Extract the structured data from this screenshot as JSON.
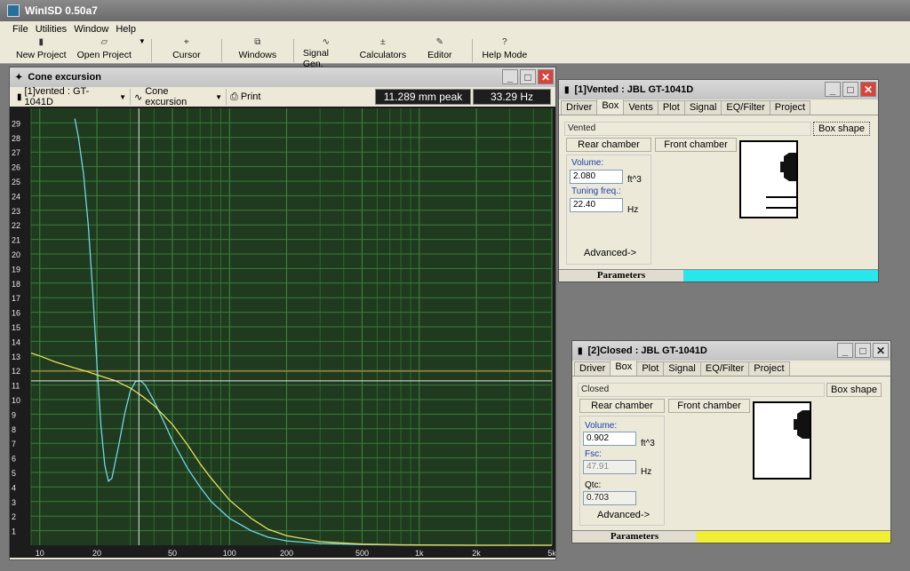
{
  "app": {
    "title": "WinISD 0.50a7"
  },
  "menu": [
    "File",
    "Utilities",
    "Window",
    "Help"
  ],
  "toolbar": [
    {
      "label": "New Project",
      "icon": "new-project-icon",
      "glyph": "▮"
    },
    {
      "label": "Open Project",
      "icon": "open-project-icon",
      "glyph": "▱"
    },
    {
      "label": "Cursor",
      "icon": "cursor-icon",
      "glyph": "⌖"
    },
    {
      "label": "Windows",
      "icon": "windows-icon",
      "glyph": "⧉"
    },
    {
      "label": "Signal Gen.",
      "icon": "signal-icon",
      "glyph": "∿"
    },
    {
      "label": "Calculators",
      "icon": "calculator-icon",
      "glyph": "±"
    },
    {
      "label": "Editor",
      "icon": "editor-icon",
      "glyph": "✎"
    },
    {
      "label": "Help Mode",
      "icon": "help-icon",
      "glyph": "?"
    }
  ],
  "cone": {
    "title": "Cone excursion",
    "project_select": "[1]vented : GT-1041D",
    "plot_select": "Cone excursion",
    "print_label": "Print",
    "readout_peak": "11.289 mm peak",
    "readout_freq": "33.29 Hz"
  },
  "chart_data": {
    "type": "line",
    "title": "",
    "xlabel": "",
    "ylabel": "",
    "xscale": "log",
    "xlim": [
      9,
      5000
    ],
    "ylim": [
      0,
      30
    ],
    "x_ticks": [
      10,
      20,
      50,
      100,
      200,
      500,
      1000,
      2000,
      5000
    ],
    "x_tick_labels": [
      "10",
      "20",
      "50",
      "100",
      "200",
      "500",
      "1k",
      "2k",
      "5k"
    ],
    "y_ticks": [
      1,
      2,
      3,
      4,
      5,
      6,
      7,
      8,
      9,
      10,
      11,
      12,
      13,
      14,
      15,
      16,
      17,
      18,
      19,
      20,
      21,
      22,
      23,
      24,
      25,
      26,
      27,
      28,
      29
    ],
    "grid": true,
    "cursor": {
      "x": 33.29,
      "y": 11.289
    },
    "limit_line_y": 11.95,
    "series": [
      {
        "name": "",
        "color": "#6fd6e8",
        "x": [
          15.3,
          16,
          17,
          18,
          19,
          20,
          21,
          22,
          23,
          24,
          26,
          28,
          30,
          32,
          34,
          36,
          40,
          45,
          50,
          60,
          70,
          80,
          100,
          130,
          160,
          200,
          300,
          500,
          800,
          1000,
          2000,
          5000
        ],
        "y": [
          29.3,
          28.0,
          25.5,
          22.0,
          17.5,
          12.5,
          8.2,
          5.5,
          4.4,
          4.6,
          6.8,
          9.0,
          10.6,
          11.25,
          11.29,
          11.0,
          9.9,
          8.5,
          7.2,
          5.3,
          4.0,
          3.0,
          1.85,
          1.0,
          0.55,
          0.3,
          0.12,
          0.05,
          0.02,
          0.01,
          0.0,
          0.0
        ]
      },
      {
        "name": "",
        "color": "#e6e05a",
        "x": [
          9,
          10,
          12,
          15,
          18,
          20,
          25,
          30,
          35,
          40,
          50,
          60,
          70,
          80,
          100,
          130,
          160,
          200,
          300,
          500,
          800,
          1000,
          2000,
          5000
        ],
        "y": [
          13.2,
          13.0,
          12.6,
          12.2,
          11.9,
          11.7,
          11.3,
          10.8,
          10.2,
          9.6,
          8.3,
          6.9,
          5.6,
          4.6,
          3.1,
          1.85,
          1.1,
          0.65,
          0.25,
          0.08,
          0.03,
          0.02,
          0.0,
          0.0
        ]
      }
    ]
  },
  "vented": {
    "title": "[1]Vented : JBL GT-1041D",
    "tabs": [
      "Driver",
      "Box",
      "Vents",
      "Plot",
      "Signal",
      "EQ/Filter",
      "Project"
    ],
    "active_tab": "Box",
    "box_type": "Vented",
    "box_shape_button": "Box shape",
    "rear_chamber": "Rear chamber",
    "front_chamber": "Front chamber",
    "volume_label": "Volume:",
    "volume_value": "2.080",
    "volume_unit": "ft^3",
    "tuning_label": "Tuning freq.:",
    "tuning_value": "22.40",
    "tuning_unit": "Hz",
    "advanced": "Advanced->",
    "params_label": "Parameters",
    "params_color": "#29e6ec"
  },
  "closed": {
    "title": "[2]Closed : JBL GT-1041D",
    "tabs": [
      "Driver",
      "Box",
      "Plot",
      "Signal",
      "EQ/Filter",
      "Project"
    ],
    "active_tab": "Box",
    "box_type": "Closed",
    "box_shape_button": "Box shape",
    "rear_chamber": "Rear chamber",
    "front_chamber": "Front chamber",
    "volume_label": "Volume:",
    "volume_value": "0.902",
    "volume_unit": "ft^3",
    "fsc_label": "Fsc:",
    "fsc_value": "47.91",
    "fsc_unit": "Hz",
    "qtc_label": "Qtc:",
    "qtc_value": "0.703",
    "advanced": "Advanced->",
    "params_label": "Parameters",
    "params_color": "#f1ef33"
  }
}
